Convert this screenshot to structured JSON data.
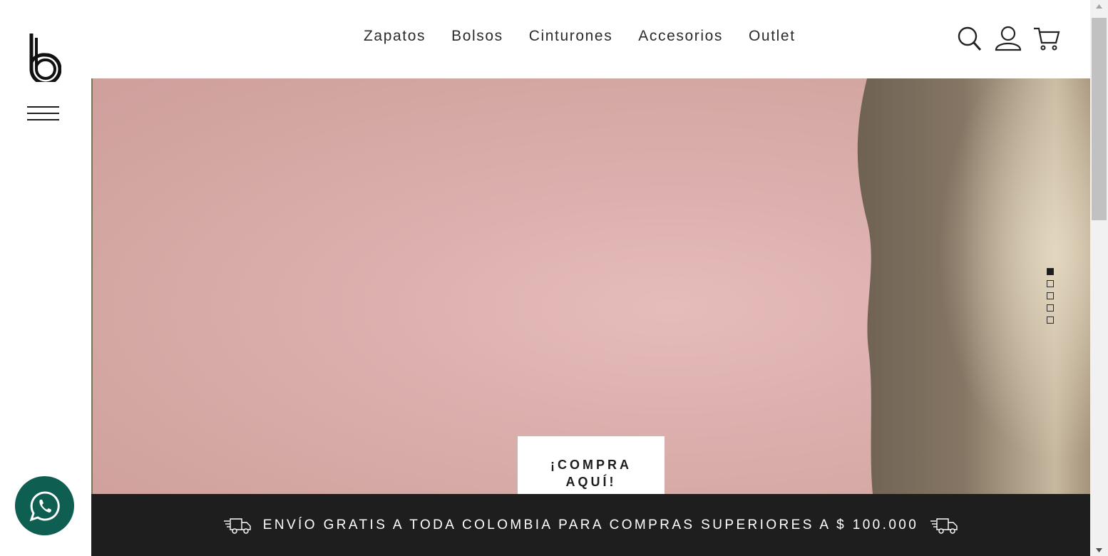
{
  "brand": {
    "logo_icon": "b-logo-icon"
  },
  "menu": {
    "icon": "hamburger-menu-icon"
  },
  "nav": {
    "items": [
      {
        "label": "Zapatos"
      },
      {
        "label": "Bolsos"
      },
      {
        "label": "Cinturones"
      },
      {
        "label": "Accesorios"
      },
      {
        "label": "Outlet"
      }
    ]
  },
  "header_icons": [
    "search-icon",
    "user-icon",
    "cart-icon"
  ],
  "hero": {
    "cta_label": "¡COMPRA AQUÍ!",
    "slide_count": 5,
    "active_slide": 1,
    "colors": {
      "background": "#dcb0ae",
      "shoe": "#8a7b69"
    }
  },
  "shipping": {
    "text": "ENVÍO GRATIS A TODA COLOMBIA PARA COMPRAS SUPERIORES A $ 100.000",
    "icon": "delivery-truck-icon",
    "background": "#1e1e1e"
  },
  "whatsapp": {
    "icon": "whatsapp-icon",
    "color": "#0f5e52"
  }
}
